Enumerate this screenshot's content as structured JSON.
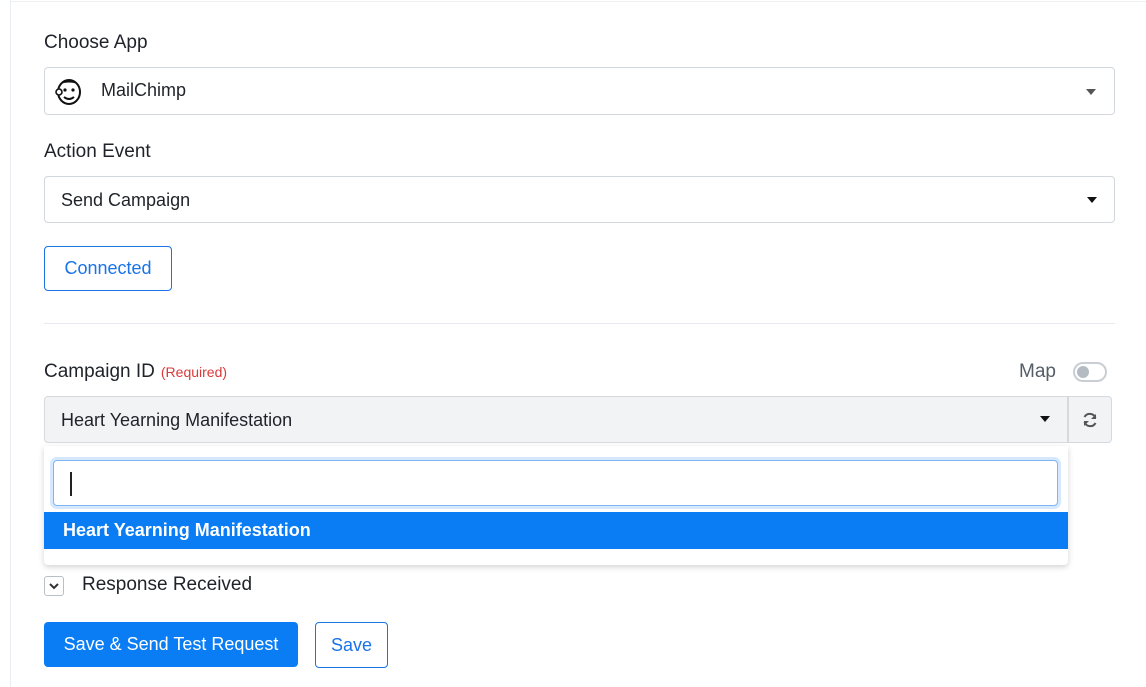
{
  "form": {
    "choose_app": {
      "label": "Choose App",
      "value": "MailChimp",
      "icon": "mailchimp-logo-icon"
    },
    "action_event": {
      "label": "Action Event",
      "value": "Send Campaign"
    },
    "connected_button": "Connected",
    "campaign_id": {
      "label": "Campaign ID",
      "required_text": "(Required)",
      "map_label": "Map",
      "map_enabled": false,
      "value": "Heart Yearning Manifestation",
      "search_value": "",
      "options": [
        "Heart Yearning Manifestation"
      ],
      "refresh_icon": "refresh-icon"
    },
    "response": {
      "label": "Response Received",
      "expanded": true
    },
    "actions": {
      "save_send_label": "Save & Send Test Request",
      "save_label": "Save"
    }
  },
  "colors": {
    "primary": "#0a7cf4",
    "required": "#d93a3a",
    "border": "#d2d7dd"
  }
}
